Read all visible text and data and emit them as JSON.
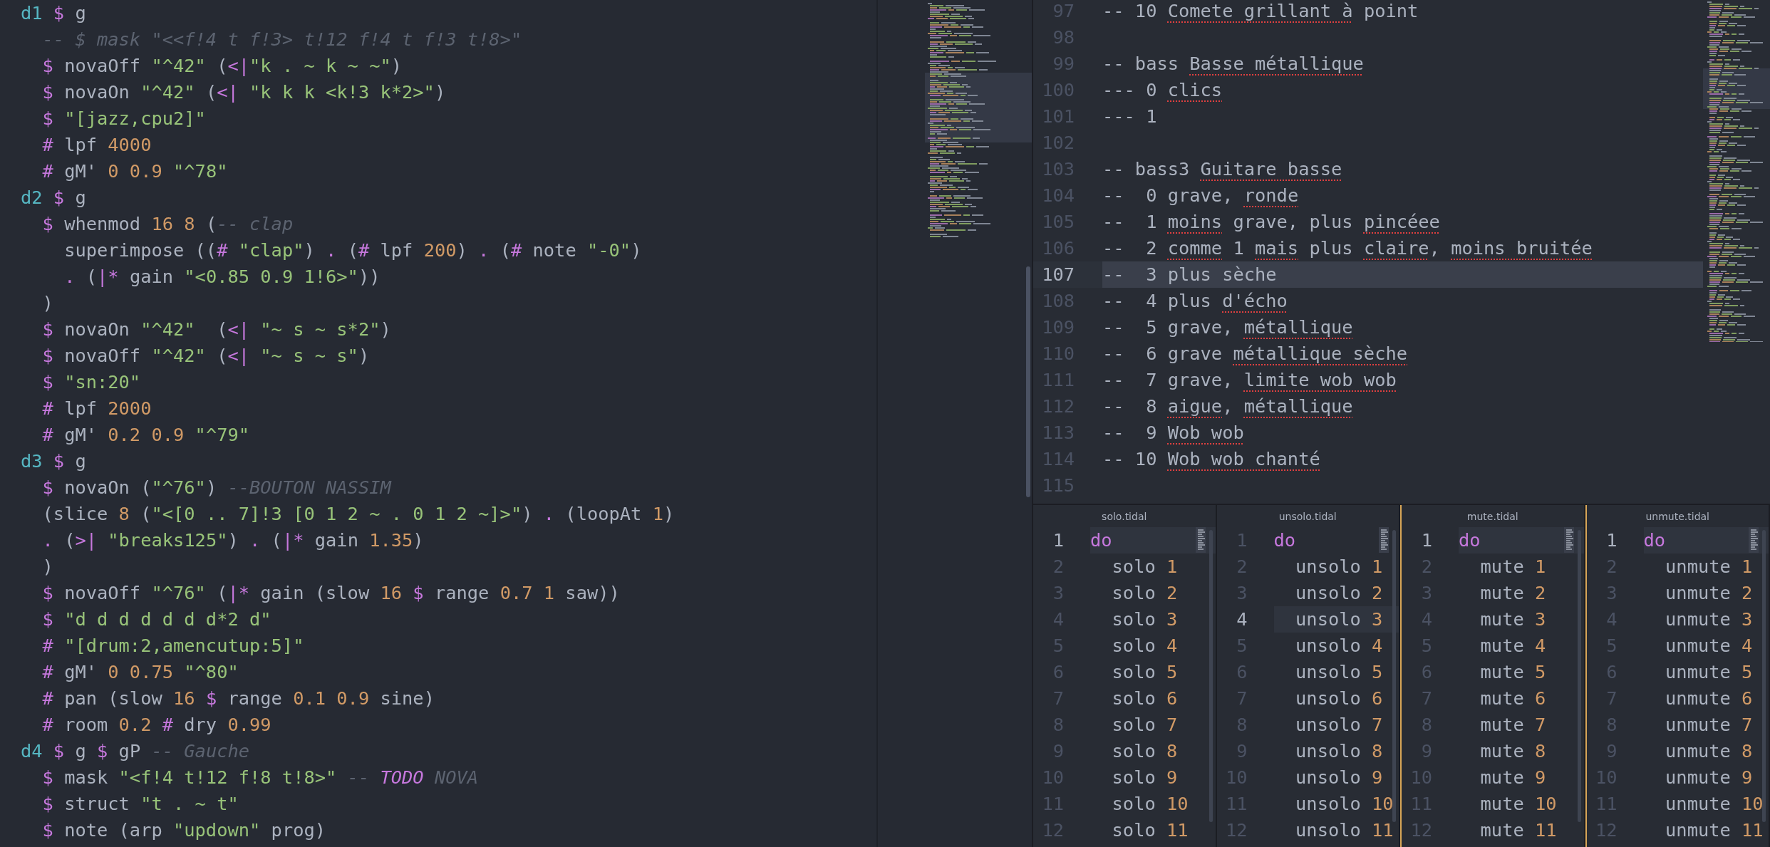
{
  "left_editor": {
    "lines": [
      [
        {
          "text": "d1",
          "kind": "chan"
        },
        {
          "text": " $",
          "kind": "op"
        },
        {
          "text": " g",
          "kind": "plain"
        }
      ],
      [
        {
          "text": "  -- $ mask \"<<f!4 t f!3> t!12 f!4 t f!3 t!8>\"",
          "kind": "com"
        }
      ],
      [
        {
          "text": "  $",
          "kind": "op"
        },
        {
          "text": " novaOff ",
          "kind": "plain"
        },
        {
          "text": "\"^42\"",
          "kind": "str"
        },
        {
          "text": " (",
          "kind": "plain"
        },
        {
          "text": "<|",
          "kind": "op"
        },
        {
          "text": "\"k . ~ k ~ ~\"",
          "kind": "str"
        },
        {
          "text": ")",
          "kind": "plain"
        }
      ],
      [
        {
          "text": "  $",
          "kind": "op"
        },
        {
          "text": " novaOn ",
          "kind": "plain"
        },
        {
          "text": "\"^42\"",
          "kind": "str"
        },
        {
          "text": " (",
          "kind": "plain"
        },
        {
          "text": "<|",
          "kind": "op"
        },
        {
          "text": " \"k k k <k!3 k*2>\"",
          "kind": "str"
        },
        {
          "text": ")",
          "kind": "plain"
        }
      ],
      [
        {
          "text": "  $",
          "kind": "op"
        },
        {
          "text": " \"[jazz,cpu2]\"",
          "kind": "str"
        }
      ],
      [
        {
          "text": "  #",
          "kind": "op"
        },
        {
          "text": " lpf ",
          "kind": "plain"
        },
        {
          "text": "4000",
          "kind": "num"
        }
      ],
      [
        {
          "text": "  #",
          "kind": "op"
        },
        {
          "text": " gM' ",
          "kind": "plain"
        },
        {
          "text": "0 0.9",
          "kind": "num"
        },
        {
          "text": " \"^78\"",
          "kind": "str"
        }
      ],
      [
        {
          "text": "d2",
          "kind": "chan"
        },
        {
          "text": " $",
          "kind": "op"
        },
        {
          "text": " g",
          "kind": "plain"
        }
      ],
      [
        {
          "text": "  $",
          "kind": "op"
        },
        {
          "text": " whenmod ",
          "kind": "plain"
        },
        {
          "text": "16 8",
          "kind": "num"
        },
        {
          "text": " (",
          "kind": "plain"
        },
        {
          "text": "-- clap",
          "kind": "com"
        }
      ],
      [
        {
          "text": "    superimpose ((",
          "kind": "plain"
        },
        {
          "text": "#",
          "kind": "op"
        },
        {
          "text": " \"clap\"",
          "kind": "str"
        },
        {
          "text": ") ",
          "kind": "plain"
        },
        {
          "text": ".",
          "kind": "op"
        },
        {
          "text": " (",
          "kind": "plain"
        },
        {
          "text": "#",
          "kind": "op"
        },
        {
          "text": " lpf ",
          "kind": "plain"
        },
        {
          "text": "200",
          "kind": "num"
        },
        {
          "text": ") ",
          "kind": "plain"
        },
        {
          "text": ".",
          "kind": "op"
        },
        {
          "text": " (",
          "kind": "plain"
        },
        {
          "text": "#",
          "kind": "op"
        },
        {
          "text": " note ",
          "kind": "plain"
        },
        {
          "text": "\"-0\"",
          "kind": "str"
        },
        {
          "text": ")",
          "kind": "plain"
        }
      ],
      [
        {
          "text": "    .",
          "kind": "op"
        },
        {
          "text": " (",
          "kind": "plain"
        },
        {
          "text": "|*",
          "kind": "op"
        },
        {
          "text": " gain ",
          "kind": "plain"
        },
        {
          "text": "\"<0.85 0.9 1!6>\"",
          "kind": "str"
        },
        {
          "text": "))",
          "kind": "plain"
        }
      ],
      [
        {
          "text": "  )",
          "kind": "plain"
        }
      ],
      [
        {
          "text": "  $",
          "kind": "op"
        },
        {
          "text": " novaOn ",
          "kind": "plain"
        },
        {
          "text": "\"^42\"",
          "kind": "str"
        },
        {
          "text": "  (",
          "kind": "plain"
        },
        {
          "text": "<|",
          "kind": "op"
        },
        {
          "text": " \"~ s ~ s*2\"",
          "kind": "str"
        },
        {
          "text": ")",
          "kind": "plain"
        }
      ],
      [
        {
          "text": "  $",
          "kind": "op"
        },
        {
          "text": " novaOff ",
          "kind": "plain"
        },
        {
          "text": "\"^42\"",
          "kind": "str"
        },
        {
          "text": " (",
          "kind": "plain"
        },
        {
          "text": "<|",
          "kind": "op"
        },
        {
          "text": " \"~ s ~ s\"",
          "kind": "str"
        },
        {
          "text": ")",
          "kind": "plain"
        }
      ],
      [
        {
          "text": "  $",
          "kind": "op"
        },
        {
          "text": " \"sn:20\"",
          "kind": "str"
        }
      ],
      [
        {
          "text": "  #",
          "kind": "op"
        },
        {
          "text": " lpf ",
          "kind": "plain"
        },
        {
          "text": "2000",
          "kind": "num"
        }
      ],
      [
        {
          "text": "  #",
          "kind": "op"
        },
        {
          "text": " gM' ",
          "kind": "plain"
        },
        {
          "text": "0.2 0.9",
          "kind": "num"
        },
        {
          "text": " \"^79\"",
          "kind": "str"
        }
      ],
      [
        {
          "text": "d3",
          "kind": "chan"
        },
        {
          "text": " $",
          "kind": "op"
        },
        {
          "text": " g",
          "kind": "plain"
        }
      ],
      [
        {
          "text": "  $",
          "kind": "op"
        },
        {
          "text": " novaOn (",
          "kind": "plain"
        },
        {
          "text": "\"^76\"",
          "kind": "str"
        },
        {
          "text": ") ",
          "kind": "plain"
        },
        {
          "text": "--BOUTON NASSIM",
          "kind": "com"
        }
      ],
      [
        {
          "text": "  (slice ",
          "kind": "plain"
        },
        {
          "text": "8",
          "kind": "num"
        },
        {
          "text": " (",
          "kind": "plain"
        },
        {
          "text": "\"<[0 .. 7]!3 [0 1 2 ~ . 0 1 2 ~]>\"",
          "kind": "str"
        },
        {
          "text": ") ",
          "kind": "plain"
        },
        {
          "text": ".",
          "kind": "op"
        },
        {
          "text": " (loopAt ",
          "kind": "plain"
        },
        {
          "text": "1",
          "kind": "num"
        },
        {
          "text": ")",
          "kind": "plain"
        }
      ],
      [
        {
          "text": "  .",
          "kind": "op"
        },
        {
          "text": " (",
          "kind": "plain"
        },
        {
          "text": ">|",
          "kind": "op"
        },
        {
          "text": " \"breaks125\"",
          "kind": "str"
        },
        {
          "text": ") ",
          "kind": "plain"
        },
        {
          "text": ".",
          "kind": "op"
        },
        {
          "text": " (",
          "kind": "plain"
        },
        {
          "text": "|*",
          "kind": "op"
        },
        {
          "text": " gain ",
          "kind": "plain"
        },
        {
          "text": "1.35",
          "kind": "num"
        },
        {
          "text": ")",
          "kind": "plain"
        }
      ],
      [
        {
          "text": "  )",
          "kind": "plain"
        }
      ],
      [
        {
          "text": "  $",
          "kind": "op"
        },
        {
          "text": " novaOff ",
          "kind": "plain"
        },
        {
          "text": "\"^76\"",
          "kind": "str"
        },
        {
          "text": " (",
          "kind": "plain"
        },
        {
          "text": "|*",
          "kind": "op"
        },
        {
          "text": " gain (slow ",
          "kind": "plain"
        },
        {
          "text": "16",
          "kind": "num"
        },
        {
          "text": " $",
          "kind": "op"
        },
        {
          "text": " range ",
          "kind": "plain"
        },
        {
          "text": "0.7 1",
          "kind": "num"
        },
        {
          "text": " saw))",
          "kind": "plain"
        }
      ],
      [
        {
          "text": "  $",
          "kind": "op"
        },
        {
          "text": " \"d d d d d d d*2 d\"",
          "kind": "str"
        }
      ],
      [
        {
          "text": "  #",
          "kind": "op"
        },
        {
          "text": " \"[drum:2,amencutup:5]\"",
          "kind": "str"
        }
      ],
      [
        {
          "text": "  #",
          "kind": "op"
        },
        {
          "text": " gM' ",
          "kind": "plain"
        },
        {
          "text": "0 0.75",
          "kind": "num"
        },
        {
          "text": " \"^80\"",
          "kind": "str"
        }
      ],
      [
        {
          "text": "  #",
          "kind": "op"
        },
        {
          "text": " pan (slow ",
          "kind": "plain"
        },
        {
          "text": "16",
          "kind": "num"
        },
        {
          "text": " $",
          "kind": "op"
        },
        {
          "text": " range ",
          "kind": "plain"
        },
        {
          "text": "0.1 0.9",
          "kind": "num"
        },
        {
          "text": " sine)",
          "kind": "plain"
        }
      ],
      [
        {
          "text": "  #",
          "kind": "op"
        },
        {
          "text": " room ",
          "kind": "plain"
        },
        {
          "text": "0.2",
          "kind": "num"
        },
        {
          "text": " #",
          "kind": "op"
        },
        {
          "text": " dry ",
          "kind": "plain"
        },
        {
          "text": "0.99",
          "kind": "num"
        }
      ],
      [
        {
          "text": "d4",
          "kind": "chan"
        },
        {
          "text": " $",
          "kind": "op"
        },
        {
          "text": " g ",
          "kind": "plain"
        },
        {
          "text": "$",
          "kind": "op"
        },
        {
          "text": " gP ",
          "kind": "plain"
        },
        {
          "text": "-- Gauche",
          "kind": "com"
        }
      ],
      [
        {
          "text": "  $",
          "kind": "op"
        },
        {
          "text": " mask ",
          "kind": "plain"
        },
        {
          "text": "\"<f!4 t!12 f!8 t!8>\"",
          "kind": "str"
        },
        {
          "text": " -- ",
          "kind": "com"
        },
        {
          "text": "TODO",
          "kind": "todo"
        },
        {
          "text": " NOVA",
          "kind": "com"
        }
      ],
      [
        {
          "text": "  $",
          "kind": "op"
        },
        {
          "text": " struct ",
          "kind": "plain"
        },
        {
          "text": "\"t . ~ t\"",
          "kind": "str"
        }
      ],
      [
        {
          "text": "  $",
          "kind": "op"
        },
        {
          "text": " note (arp ",
          "kind": "plain"
        },
        {
          "text": "\"updown\"",
          "kind": "str"
        },
        {
          "text": " prog)",
          "kind": "plain"
        }
      ]
    ]
  },
  "notes_editor": {
    "lines": [
      {
        "no": "97",
        "current": false,
        "tokens": [
          {
            "text": "-- 10 ",
            "kind": "plain"
          },
          {
            "text": "Comete grillant à",
            "kind": "spell"
          },
          {
            "text": " point",
            "kind": "plain"
          }
        ]
      },
      {
        "no": "98",
        "current": false
      },
      {
        "no": "99",
        "current": false,
        "tokens": [
          {
            "text": "-- bass ",
            "kind": "plain"
          },
          {
            "text": "Basse métallique",
            "kind": "spell"
          }
        ]
      },
      {
        "no": "100",
        "current": false,
        "tokens": [
          {
            "text": "--- 0 ",
            "kind": "plain"
          },
          {
            "text": "clics",
            "kind": "spell"
          }
        ]
      },
      {
        "no": "101",
        "current": false,
        "tokens": [
          {
            "text": "--- 1",
            "kind": "plain"
          }
        ]
      },
      {
        "no": "102",
        "current": false
      },
      {
        "no": "103",
        "current": false,
        "tokens": [
          {
            "text": "-- bass3 ",
            "kind": "plain"
          },
          {
            "text": "Guitare basse",
            "kind": "spell"
          }
        ]
      },
      {
        "no": "104",
        "current": false,
        "tokens": [
          {
            "text": "--  0 grave, ",
            "kind": "plain"
          },
          {
            "text": "ronde",
            "kind": "spell"
          }
        ]
      },
      {
        "no": "105",
        "current": false,
        "tokens": [
          {
            "text": "--  1 ",
            "kind": "plain"
          },
          {
            "text": "moins",
            "kind": "spell"
          },
          {
            "text": " grave, plus ",
            "kind": "plain"
          },
          {
            "text": "pincéee",
            "kind": "spell"
          }
        ]
      },
      {
        "no": "106",
        "current": false,
        "tokens": [
          {
            "text": "--  2 ",
            "kind": "plain"
          },
          {
            "text": "comme",
            "kind": "spell"
          },
          {
            "text": " 1 ",
            "kind": "plain"
          },
          {
            "text": "mais",
            "kind": "spell"
          },
          {
            "text": " plus ",
            "kind": "plain"
          },
          {
            "text": "claire",
            "kind": "spell"
          },
          {
            "text": ", ",
            "kind": "plain"
          },
          {
            "text": "moins bruitée",
            "kind": "spell"
          }
        ]
      },
      {
        "no": "107",
        "current": true,
        "tokens": [
          {
            "text": "--  3 plus sèche",
            "kind": "plain"
          }
        ]
      },
      {
        "no": "108",
        "current": false,
        "tokens": [
          {
            "text": "--  4 plus ",
            "kind": "plain"
          },
          {
            "text": "d'écho",
            "kind": "spell"
          }
        ]
      },
      {
        "no": "109",
        "current": false,
        "tokens": [
          {
            "text": "--  5 grave, ",
            "kind": "plain"
          },
          {
            "text": "métallique",
            "kind": "spell"
          }
        ]
      },
      {
        "no": "110",
        "current": false,
        "tokens": [
          {
            "text": "--  6 grave ",
            "kind": "plain"
          },
          {
            "text": "métallique sèche",
            "kind": "spell"
          }
        ]
      },
      {
        "no": "111",
        "current": false,
        "tokens": [
          {
            "text": "--  7 grave, ",
            "kind": "plain"
          },
          {
            "text": "limite wob wob",
            "kind": "spell"
          }
        ]
      },
      {
        "no": "112",
        "current": false,
        "tokens": [
          {
            "text": "--  8 ",
            "kind": "plain"
          },
          {
            "text": "aigue",
            "kind": "spell"
          },
          {
            "text": ", ",
            "kind": "plain"
          },
          {
            "text": "métallique",
            "kind": "spell"
          }
        ]
      },
      {
        "no": "113",
        "current": false,
        "tokens": [
          {
            "text": "--  9 ",
            "kind": "plain"
          },
          {
            "text": "Wob wob",
            "kind": "spell"
          }
        ]
      },
      {
        "no": "114",
        "current": false,
        "tokens": [
          {
            "text": "-- 10 ",
            "kind": "plain"
          },
          {
            "text": "Wob wob chanté",
            "kind": "spell"
          }
        ]
      },
      {
        "no": "115",
        "current": false
      }
    ]
  },
  "panes": [
    {
      "title": "solo.tidal",
      "marked": false,
      "lines": [
        {
          "no": "1",
          "current": true,
          "tokens": [
            {
              "text": "do",
              "kind": "op"
            }
          ]
        },
        {
          "no": "2",
          "current": false,
          "tokens": [
            {
              "text": "  solo ",
              "kind": "plain"
            },
            {
              "text": "1",
              "kind": "num"
            }
          ]
        },
        {
          "no": "3",
          "current": false,
          "tokens": [
            {
              "text": "  solo ",
              "kind": "plain"
            },
            {
              "text": "2",
              "kind": "num"
            }
          ]
        },
        {
          "no": "4",
          "current": false,
          "tokens": [
            {
              "text": "  solo ",
              "kind": "plain"
            },
            {
              "text": "3",
              "kind": "num"
            }
          ]
        },
        {
          "no": "5",
          "current": false,
          "tokens": [
            {
              "text": "  solo ",
              "kind": "plain"
            },
            {
              "text": "4",
              "kind": "num"
            }
          ]
        },
        {
          "no": "6",
          "current": false,
          "tokens": [
            {
              "text": "  solo ",
              "kind": "plain"
            },
            {
              "text": "5",
              "kind": "num"
            }
          ]
        },
        {
          "no": "7",
          "current": false,
          "tokens": [
            {
              "text": "  solo ",
              "kind": "plain"
            },
            {
              "text": "6",
              "kind": "num"
            }
          ]
        },
        {
          "no": "8",
          "current": false,
          "tokens": [
            {
              "text": "  solo ",
              "kind": "plain"
            },
            {
              "text": "7",
              "kind": "num"
            }
          ]
        },
        {
          "no": "9",
          "current": false,
          "tokens": [
            {
              "text": "  solo ",
              "kind": "plain"
            },
            {
              "text": "8",
              "kind": "num"
            }
          ]
        },
        {
          "no": "10",
          "current": false,
          "tokens": [
            {
              "text": "  solo ",
              "kind": "plain"
            },
            {
              "text": "9",
              "kind": "num"
            }
          ]
        },
        {
          "no": "11",
          "current": false,
          "tokens": [
            {
              "text": "  solo ",
              "kind": "plain"
            },
            {
              "text": "10",
              "kind": "num"
            }
          ]
        },
        {
          "no": "12",
          "current": false,
          "tokens": [
            {
              "text": "  solo ",
              "kind": "plain"
            },
            {
              "text": "11",
              "kind": "num"
            }
          ]
        }
      ]
    },
    {
      "title": "unsolo.tidal",
      "marked": false,
      "lines": [
        {
          "no": "1",
          "current": false,
          "tokens": [
            {
              "text": "do",
              "kind": "op"
            }
          ]
        },
        {
          "no": "2",
          "current": false,
          "tokens": [
            {
              "text": "  unsolo ",
              "kind": "plain"
            },
            {
              "text": "1",
              "kind": "num"
            }
          ]
        },
        {
          "no": "3",
          "current": false,
          "tokens": [
            {
              "text": "  unsolo ",
              "kind": "plain"
            },
            {
              "text": "2",
              "kind": "num"
            }
          ]
        },
        {
          "no": "4",
          "current": true,
          "tokens": [
            {
              "text": "  unsolo ",
              "kind": "plain"
            },
            {
              "text": "3",
              "kind": "num"
            }
          ]
        },
        {
          "no": "5",
          "current": false,
          "tokens": [
            {
              "text": "  unsolo ",
              "kind": "plain"
            },
            {
              "text": "4",
              "kind": "num"
            }
          ]
        },
        {
          "no": "6",
          "current": false,
          "tokens": [
            {
              "text": "  unsolo ",
              "kind": "plain"
            },
            {
              "text": "5",
              "kind": "num"
            }
          ]
        },
        {
          "no": "7",
          "current": false,
          "tokens": [
            {
              "text": "  unsolo ",
              "kind": "plain"
            },
            {
              "text": "6",
              "kind": "num"
            }
          ]
        },
        {
          "no": "8",
          "current": false,
          "tokens": [
            {
              "text": "  unsolo ",
              "kind": "plain"
            },
            {
              "text": "7",
              "kind": "num"
            }
          ]
        },
        {
          "no": "9",
          "current": false,
          "tokens": [
            {
              "text": "  unsolo ",
              "kind": "plain"
            },
            {
              "text": "8",
              "kind": "num"
            }
          ]
        },
        {
          "no": "10",
          "current": false,
          "tokens": [
            {
              "text": "  unsolo ",
              "kind": "plain"
            },
            {
              "text": "9",
              "kind": "num"
            }
          ]
        },
        {
          "no": "11",
          "current": false,
          "tokens": [
            {
              "text": "  unsolo ",
              "kind": "plain"
            },
            {
              "text": "10",
              "kind": "num"
            }
          ]
        },
        {
          "no": "12",
          "current": false,
          "tokens": [
            {
              "text": "  unsolo ",
              "kind": "plain"
            },
            {
              "text": "11",
              "kind": "num"
            }
          ]
        }
      ]
    },
    {
      "title": "mute.tidal",
      "marked": true,
      "lines": [
        {
          "no": "1",
          "current": true,
          "tokens": [
            {
              "text": "do",
              "kind": "op"
            }
          ]
        },
        {
          "no": "2",
          "current": false,
          "tokens": [
            {
              "text": "  mute ",
              "kind": "plain"
            },
            {
              "text": "1",
              "kind": "num"
            }
          ]
        },
        {
          "no": "3",
          "current": false,
          "tokens": [
            {
              "text": "  mute ",
              "kind": "plain"
            },
            {
              "text": "2",
              "kind": "num"
            }
          ]
        },
        {
          "no": "4",
          "current": false,
          "tokens": [
            {
              "text": "  mute ",
              "kind": "plain"
            },
            {
              "text": "3",
              "kind": "num"
            }
          ]
        },
        {
          "no": "5",
          "current": false,
          "tokens": [
            {
              "text": "  mute ",
              "kind": "plain"
            },
            {
              "text": "4",
              "kind": "num"
            }
          ]
        },
        {
          "no": "6",
          "current": false,
          "tokens": [
            {
              "text": "  mute ",
              "kind": "plain"
            },
            {
              "text": "5",
              "kind": "num"
            }
          ]
        },
        {
          "no": "7",
          "current": false,
          "tokens": [
            {
              "text": "  mute ",
              "kind": "plain"
            },
            {
              "text": "6",
              "kind": "num"
            }
          ]
        },
        {
          "no": "8",
          "current": false,
          "tokens": [
            {
              "text": "  mute ",
              "kind": "plain"
            },
            {
              "text": "7",
              "kind": "num"
            }
          ]
        },
        {
          "no": "9",
          "current": false,
          "tokens": [
            {
              "text": "  mute ",
              "kind": "plain"
            },
            {
              "text": "8",
              "kind": "num"
            }
          ]
        },
        {
          "no": "10",
          "current": false,
          "tokens": [
            {
              "text": "  mute ",
              "kind": "plain"
            },
            {
              "text": "9",
              "kind": "num"
            }
          ]
        },
        {
          "no": "11",
          "current": false,
          "tokens": [
            {
              "text": "  mute ",
              "kind": "plain"
            },
            {
              "text": "10",
              "kind": "num"
            }
          ]
        },
        {
          "no": "12",
          "current": false,
          "tokens": [
            {
              "text": "  mute ",
              "kind": "plain"
            },
            {
              "text": "11",
              "kind": "num"
            }
          ]
        }
      ]
    },
    {
      "title": "unmute.tidal",
      "marked": true,
      "lines": [
        {
          "no": "1",
          "current": true,
          "tokens": [
            {
              "text": "do",
              "kind": "op"
            }
          ]
        },
        {
          "no": "2",
          "current": false,
          "tokens": [
            {
              "text": "  unmute ",
              "kind": "plain"
            },
            {
              "text": "1",
              "kind": "num"
            }
          ]
        },
        {
          "no": "3",
          "current": false,
          "tokens": [
            {
              "text": "  unmute ",
              "kind": "plain"
            },
            {
              "text": "2",
              "kind": "num"
            }
          ]
        },
        {
          "no": "4",
          "current": false,
          "tokens": [
            {
              "text": "  unmute ",
              "kind": "plain"
            },
            {
              "text": "3",
              "kind": "num"
            }
          ]
        },
        {
          "no": "5",
          "current": false,
          "tokens": [
            {
              "text": "  unmute ",
              "kind": "plain"
            },
            {
              "text": "4",
              "kind": "num"
            }
          ]
        },
        {
          "no": "6",
          "current": false,
          "tokens": [
            {
              "text": "  unmute ",
              "kind": "plain"
            },
            {
              "text": "5",
              "kind": "num"
            }
          ]
        },
        {
          "no": "7",
          "current": false,
          "tokens": [
            {
              "text": "  unmute ",
              "kind": "plain"
            },
            {
              "text": "6",
              "kind": "num"
            }
          ]
        },
        {
          "no": "8",
          "current": false,
          "tokens": [
            {
              "text": "  unmute ",
              "kind": "plain"
            },
            {
              "text": "7",
              "kind": "num"
            }
          ]
        },
        {
          "no": "9",
          "current": false,
          "tokens": [
            {
              "text": "  unmute ",
              "kind": "plain"
            },
            {
              "text": "8",
              "kind": "num"
            }
          ]
        },
        {
          "no": "10",
          "current": false,
          "tokens": [
            {
              "text": "  unmute ",
              "kind": "plain"
            },
            {
              "text": "9",
              "kind": "num"
            }
          ]
        },
        {
          "no": "11",
          "current": false,
          "tokens": [
            {
              "text": "  unmute ",
              "kind": "plain"
            },
            {
              "text": "10",
              "kind": "num"
            }
          ]
        },
        {
          "no": "12",
          "current": false,
          "tokens": [
            {
              "text": "  unmute ",
              "kind": "plain"
            },
            {
              "text": "11",
              "kind": "num"
            }
          ]
        }
      ]
    }
  ]
}
